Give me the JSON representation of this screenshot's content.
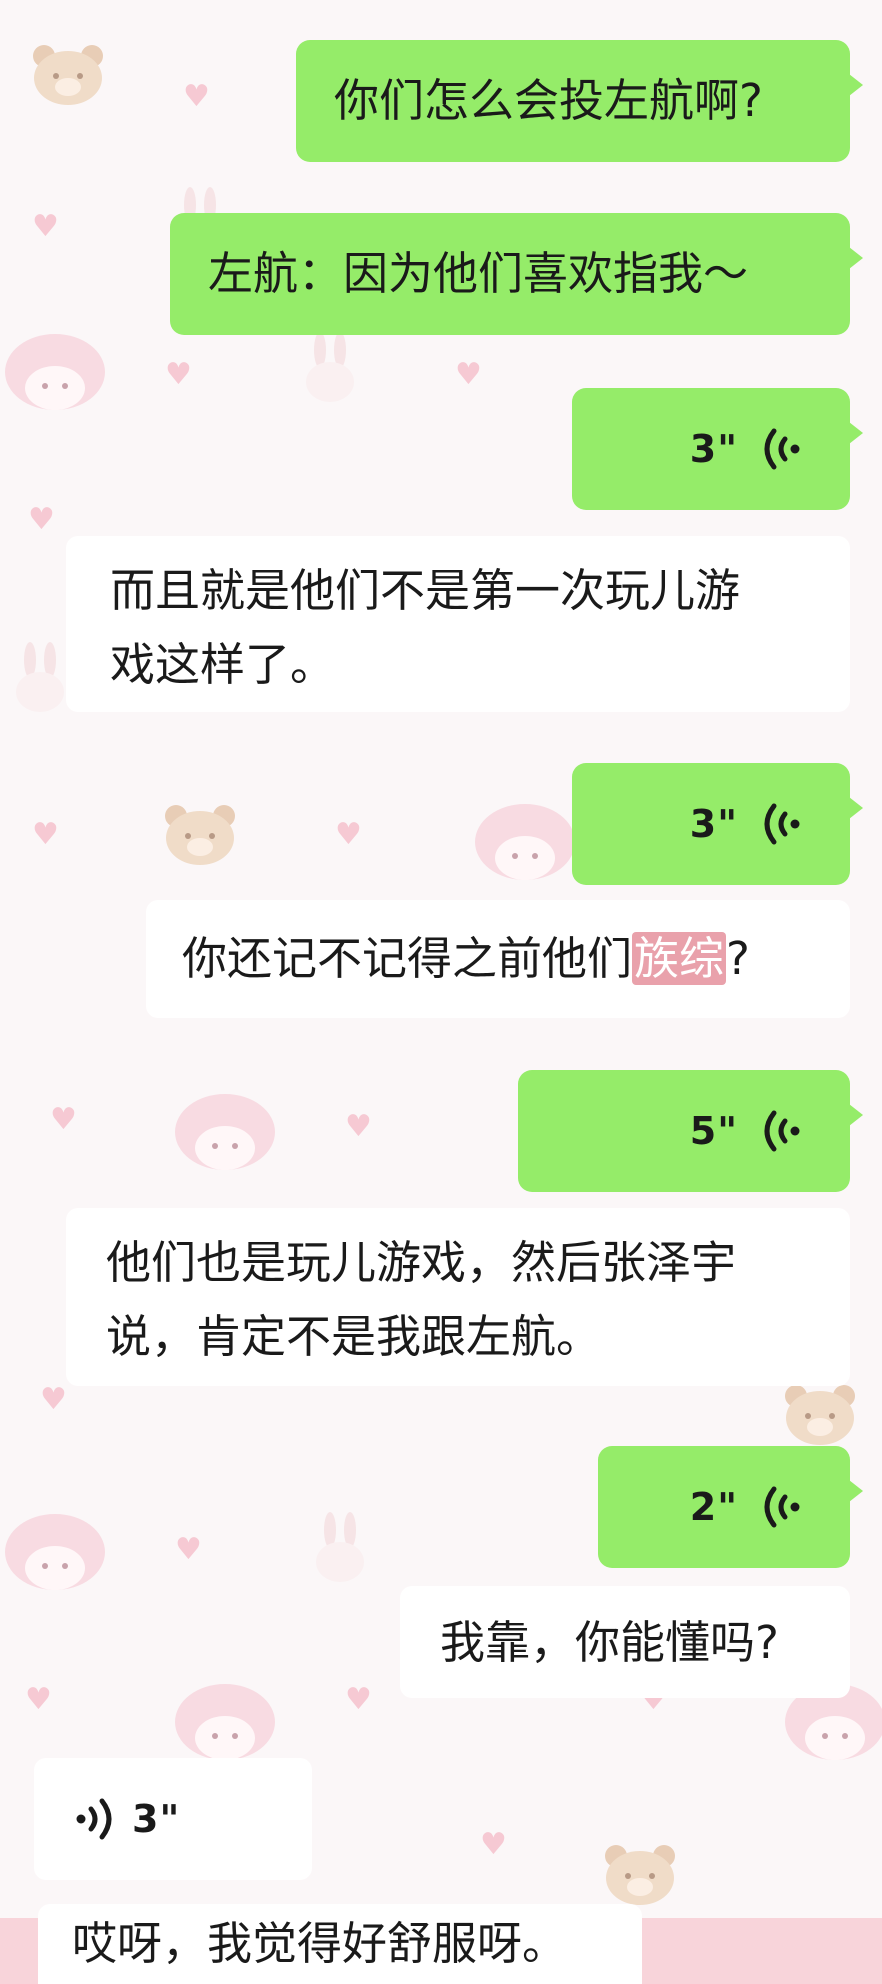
{
  "chat": {
    "messages": [
      {
        "direction": "out",
        "type": "text",
        "text": "你们怎么会投左航啊?"
      },
      {
        "direction": "out",
        "type": "text",
        "text": "左航：因为他们喜欢指我～"
      },
      {
        "direction": "out",
        "type": "voice",
        "duration": "3\""
      },
      {
        "direction": "in",
        "type": "text",
        "line1": "而且就是他们不是第一次玩儿游",
        "line2": "戏这样了。"
      },
      {
        "direction": "out",
        "type": "voice",
        "duration": "3\""
      },
      {
        "direction": "in",
        "type": "text",
        "before": "你还记不记得之前他们",
        "highlight": "族综",
        "after": "?"
      },
      {
        "direction": "out",
        "type": "voice",
        "duration": "5\""
      },
      {
        "direction": "in",
        "type": "text",
        "line1": "他们也是玩儿游戏，然后张泽宇",
        "line2": "说，肯定不是我跟左航。"
      },
      {
        "direction": "out",
        "type": "voice",
        "duration": "2\""
      },
      {
        "direction": "in",
        "type": "text",
        "text": "我靠，你能懂吗?"
      },
      {
        "direction": "in",
        "type": "voice",
        "duration": "3\""
      },
      {
        "direction": "in",
        "type": "text",
        "text": "哎呀，我觉得好舒服呀。"
      }
    ]
  },
  "colors": {
    "outgoing": "#95ec69",
    "incoming": "#ffffff",
    "highlight": "#e9a1ab",
    "background": "#fbf7f8"
  },
  "icons": {
    "voice_out": "voice-wave-icon",
    "voice_in": "voice-wave-icon"
  }
}
